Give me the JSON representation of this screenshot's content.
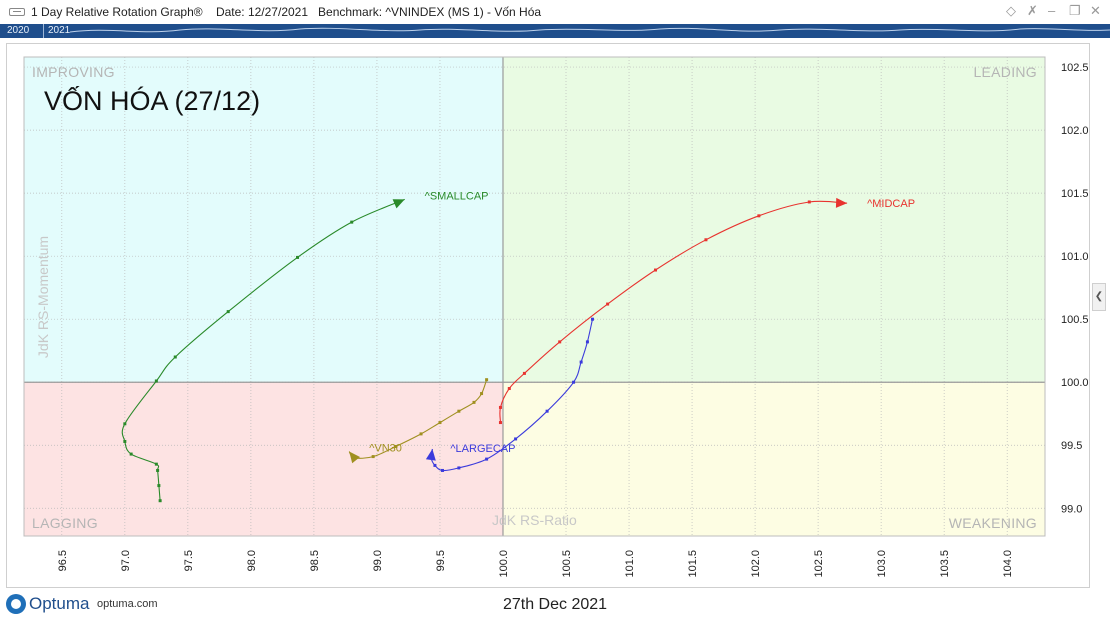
{
  "window": {
    "title": "1 Day Relative Rotation Graph®",
    "date_label": "Date: 12/27/2021",
    "benchmark_label": "Benchmark:  ^VNINDEX (MS 1) - Vốn Hóa"
  },
  "timebar": {
    "years": [
      "2020",
      "2021"
    ]
  },
  "footer": {
    "brand": "Optuma",
    "site": "optuma.com",
    "date": "27th Dec 2021"
  },
  "colors": {
    "improving": "#e3fcfc",
    "leading": "#e9fbe3",
    "lagging": "#fde3e3",
    "weakening": "#fdfde3",
    "smallcap": "#2a8a2a",
    "midcap": "#e8332f",
    "vn30": "#a09020",
    "largecap": "#3b3bdc"
  },
  "chart_data": {
    "type": "scatter",
    "title": "VỐN HÓA (27/12)",
    "xlabel": "JdK RS-Ratio",
    "ylabel": "JdK RS-Momentum",
    "xlim": [
      96.2,
      104.3
    ],
    "ylim": [
      98.78,
      102.58
    ],
    "x_ticks": [
      "96.5",
      "97.0",
      "97.5",
      "98.0",
      "98.5",
      "99.0",
      "99.5",
      "100.0",
      "100.5",
      "101.0",
      "101.5",
      "102.0",
      "102.5",
      "103.0",
      "103.5",
      "104.0"
    ],
    "y_ticks": [
      "99.0",
      "99.5",
      "100.0",
      "100.5",
      "101.0",
      "101.5",
      "102.0",
      "102.5"
    ],
    "quadrants": {
      "top_left": "IMPROVING",
      "top_right": "LEADING",
      "bottom_left": "LAGGING",
      "bottom_right": "WEAKENING"
    },
    "grid": true,
    "series": [
      {
        "name": "^SMALLCAP",
        "color": "smallcap",
        "x": [
          97.28,
          97.27,
          97.26,
          97.25,
          97.05,
          97.0,
          97.0,
          97.25,
          97.4,
          97.82,
          98.37,
          98.8,
          99.22
        ],
        "y": [
          99.06,
          99.18,
          99.3,
          99.35,
          99.43,
          99.53,
          99.67,
          100.01,
          100.2,
          100.56,
          100.99,
          101.27,
          101.45
        ]
      },
      {
        "name": "^MIDCAP",
        "color": "midcap",
        "x": [
          99.98,
          99.98,
          100.05,
          100.17,
          100.45,
          100.83,
          101.21,
          101.61,
          102.03,
          102.43,
          102.73
        ],
        "y": [
          99.68,
          99.8,
          99.95,
          100.07,
          100.32,
          100.62,
          100.89,
          101.13,
          101.32,
          101.43,
          101.42
        ]
      },
      {
        "name": "^VN30",
        "color": "vn30",
        "x": [
          99.87,
          99.83,
          99.77,
          99.65,
          99.5,
          99.35,
          99.15,
          98.97,
          98.82,
          98.78
        ],
        "y": [
          100.02,
          99.91,
          99.84,
          99.77,
          99.68,
          99.59,
          99.49,
          99.41,
          99.4,
          99.45
        ]
      },
      {
        "name": "^LARGECAP",
        "color": "largecap",
        "x": [
          100.71,
          100.67,
          100.62,
          100.56,
          100.35,
          100.1,
          99.87,
          99.65,
          99.52,
          99.46,
          99.43,
          99.44
        ],
        "y": [
          100.5,
          100.32,
          100.16,
          100.0,
          99.77,
          99.55,
          99.39,
          99.32,
          99.3,
          99.34,
          99.4,
          99.47
        ]
      }
    ]
  }
}
